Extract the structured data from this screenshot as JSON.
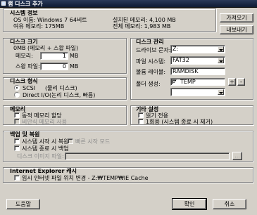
{
  "window": {
    "title": "램 디스크 추가"
  },
  "system_info": {
    "title": "시스템 정보",
    "os_name": "OS 이름: Windows 7 64비트",
    "free_memory": "여유 메모리: 175MB",
    "installed_memory": "설치된 메모리: 4,100 MB",
    "total_memory": "전체 메모리: 1,983 MB"
  },
  "side_buttons": {
    "import": "가져오기",
    "export": "내보내기"
  },
  "disk_size": {
    "title": "디스크 크기",
    "summary": "0MB (메모리 + 스왑 파일)",
    "memory_label": "메모리:",
    "memory_value": "1",
    "memory_unit": "MB",
    "swap_label": "스왑 파일:",
    "swap_value": "0",
    "swap_unit": "MB"
  },
  "disk_format": {
    "title": "디스크 형식",
    "scsi": "SCSI",
    "scsi_desc": "(물리 디스크)",
    "direct": "Direct I/O",
    "direct_desc": "(논리 디스크, 빠름)"
  },
  "disk_management": {
    "title": "디스크 관리",
    "drive_label": "드라이브 문자:",
    "drive_value": "Z:",
    "fs_label": "파일 시스템:",
    "fs_value": "FAT32",
    "volume_label": "볼륨 레이블:",
    "volume_value": "RAMDISK",
    "folder_label": "폴더 생성:",
    "folder_value": "TEMP",
    "add_symbol": "+",
    "remove_symbol": "-"
  },
  "memory": {
    "title": "메모리",
    "dynamic": "동적 메모리 할당",
    "paged": "비안식 메모리 사용"
  },
  "other_settings": {
    "title": "기타 설정",
    "read_only": "읽기 전용",
    "one_time": "1회용 (시스템 종료 시 제거)"
  },
  "backup": {
    "title": "백업 및 복원",
    "restore_on_start": "시스템 시작 시 복원",
    "quick_start": "빠른 시작 모드",
    "backup_on_shutdown": "시스템 종료 시 백업",
    "image_file_label": "디스크 이미지 파일:",
    "browse": "..."
  },
  "ie_cache": {
    "title": "Internet Explorer 캐시",
    "move_cache": "임시 인터넷 파일 위치 변경 - Z:₩TEMP₩IE Cache"
  },
  "bottom_buttons": {
    "help": "도움말",
    "ok": "확인",
    "cancel": "취소"
  }
}
